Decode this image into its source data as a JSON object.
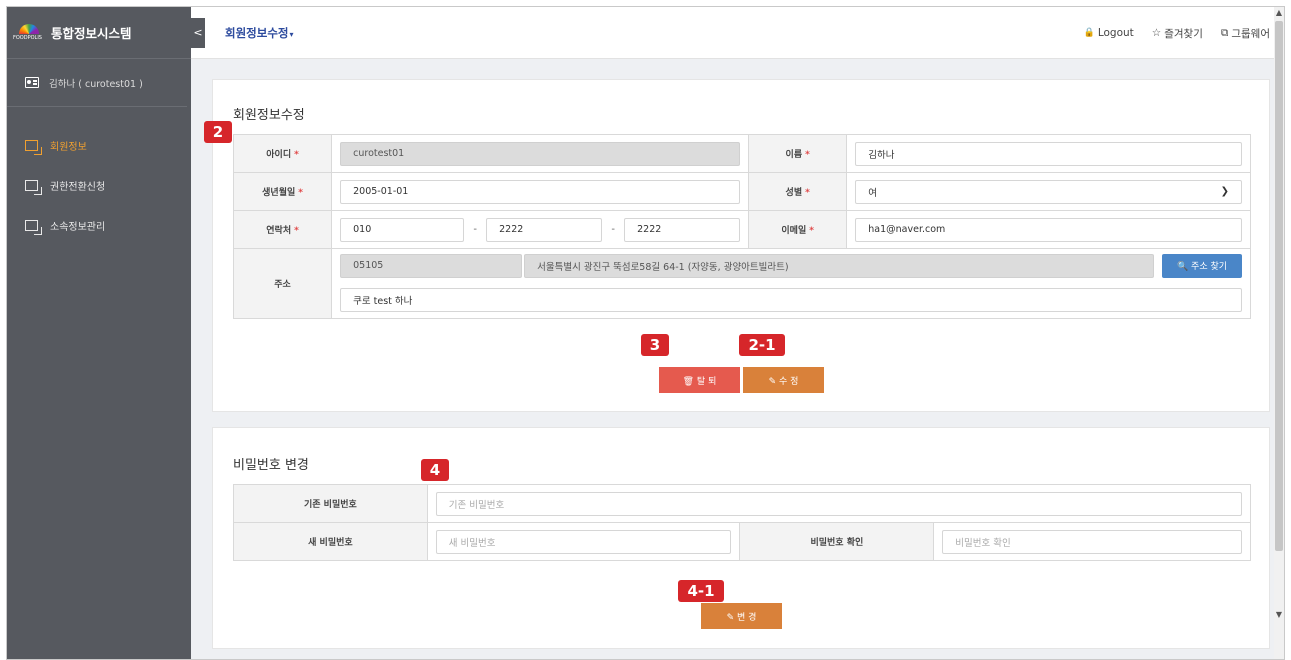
{
  "app": {
    "title": "통합정보시스템",
    "logo_text": "FOODPOLIS"
  },
  "user": {
    "display": "김하나 ( curotest01 )"
  },
  "sidebar": {
    "items": [
      {
        "label": "회원정보",
        "active": true
      },
      {
        "label": "권한전환신청",
        "active": false
      },
      {
        "label": "소속정보관리",
        "active": false
      }
    ]
  },
  "header": {
    "collapse_glyph": "<",
    "page_title": "회원정보수정",
    "caret": "▾",
    "links": [
      {
        "icon": "lock-icon",
        "glyph": "🔒",
        "label": "Logout"
      },
      {
        "icon": "star-icon",
        "glyph": "☆",
        "label": "즐겨찾기"
      },
      {
        "icon": "external-link-icon",
        "glyph": "⧉",
        "label": "그룹웨어"
      }
    ]
  },
  "member_form": {
    "title": "회원정보수정",
    "required_mark": "*",
    "id_label": "아이디",
    "id_value": "curotest01",
    "name_label": "이름",
    "name_value": "김하나",
    "birth_label": "생년월일",
    "birth_value": "2005-01-01",
    "gender_label": "성별",
    "gender_value": "여",
    "phone_label": "연락처",
    "phone1": "010",
    "phone2": "2222",
    "phone3": "2222",
    "phone_sep": "-",
    "email_label": "이메일",
    "email_value": "ha1@naver.com",
    "address_label": "주소",
    "zipcode": "05105",
    "address1": "서울특별시 광진구 뚝섬로58길 64-1 (자양동, 광양아트빌라트)",
    "address2": "쿠로 test 하나",
    "address_search_button": "🔍 주소 찾기",
    "withdraw_button": "🗑 탈 퇴",
    "edit_button": "✎ 수 정"
  },
  "password_form": {
    "title": "비밀번호 변경",
    "current_label": "기존 비밀번호",
    "current_placeholder": "기존 비밀번호",
    "new_label": "새 비밀번호",
    "new_placeholder": "새 비밀번호",
    "confirm_label": "비밀번호 확인",
    "confirm_placeholder": "비밀번호 확인",
    "change_button": "✎ 변 경"
  },
  "markers": {
    "m2": "2",
    "m3": "3",
    "m2_1": "2-1",
    "m4": "4",
    "m4_1": "4-1"
  },
  "colors": {
    "sidebar_bg": "#56595f",
    "active_menu": "#f0a030",
    "title_blue": "#2d4b9e",
    "withdraw_red": "#e55a4e",
    "edit_orange": "#d9813a",
    "search_blue": "#4a86c8",
    "marker_red": "#d6262a"
  }
}
